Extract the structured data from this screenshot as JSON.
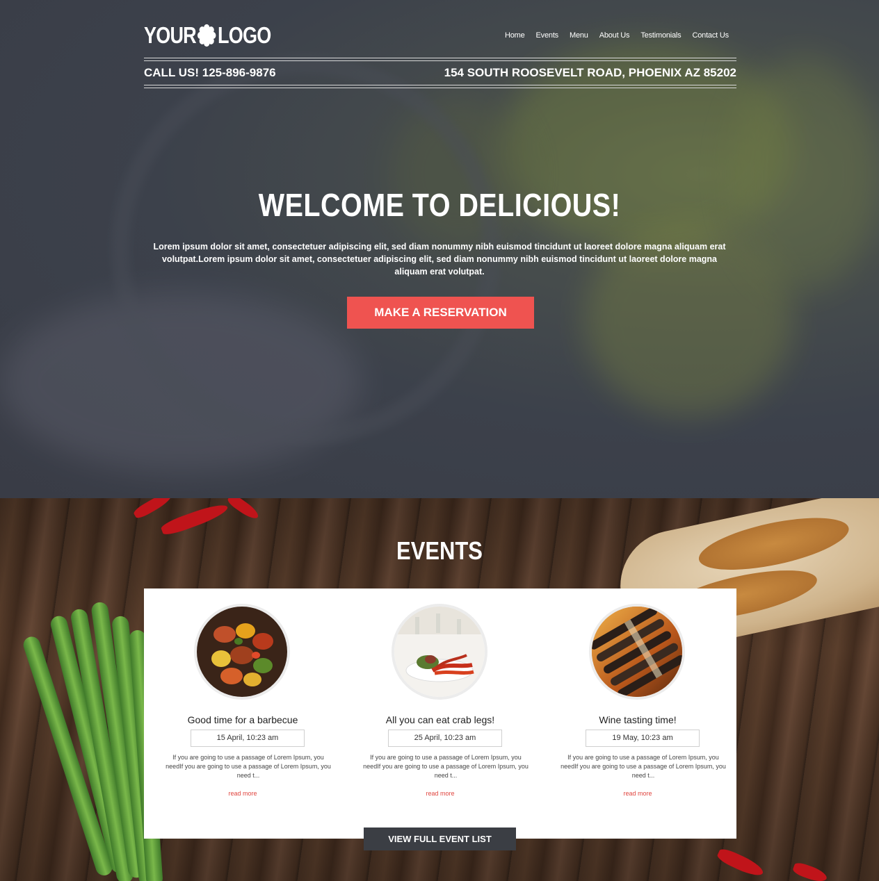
{
  "header": {
    "logo_left": "YOUR",
    "logo_right": "LOGO",
    "nav": [
      "Home",
      "Events",
      "Menu",
      "About Us",
      "Testimonials",
      "Contact Us"
    ],
    "phone": "CALL US! 125-896-9876",
    "address": "154 SOUTH ROOSEVELT ROAD, PHOENIX AZ 85202"
  },
  "hero": {
    "title": "WELCOME TO DELICIOUS!",
    "text": "Lorem ipsum dolor sit amet, consectetuer adipiscing elit, sed diam nonummy nibh euismod tincidunt ut laoreet dolore magna aliquam erat volutpat.Lorem ipsum dolor sit amet, consectetuer adipiscing elit, sed diam nonummy nibh euismod tincidunt ut laoreet dolore magna aliquam erat volutpat.",
    "cta": "MAKE A RESERVATION"
  },
  "events": {
    "title": "EVENTS",
    "items": [
      {
        "title": "Good time for a barbecue",
        "date": "15 April, 10:23 am",
        "desc": "If you are going to use a passage of Lorem Ipsum, you needIf you are going to use a passage of Lorem Ipsum, you need t...",
        "more": "read more"
      },
      {
        "title": "All you can eat crab legs!",
        "date": "25 April, 10:23 am",
        "desc": "If you are going to use a passage of Lorem Ipsum, you needIf you are going to use a passage of Lorem Ipsum, you need t...",
        "more": "read more"
      },
      {
        "title": "Wine tasting time!",
        "date": "19 May, 10:23 am",
        "desc": "If you are going to use a passage of Lorem Ipsum, you needIf you are going to use a passage of Lorem Ipsum, you need t...",
        "more": "read more"
      }
    ],
    "full_list": "VIEW FULL EVENT LIST"
  },
  "colors": {
    "accent": "#ef5350",
    "dark_button": "#3b3e44",
    "hero_overlay": "#3a3d46"
  }
}
